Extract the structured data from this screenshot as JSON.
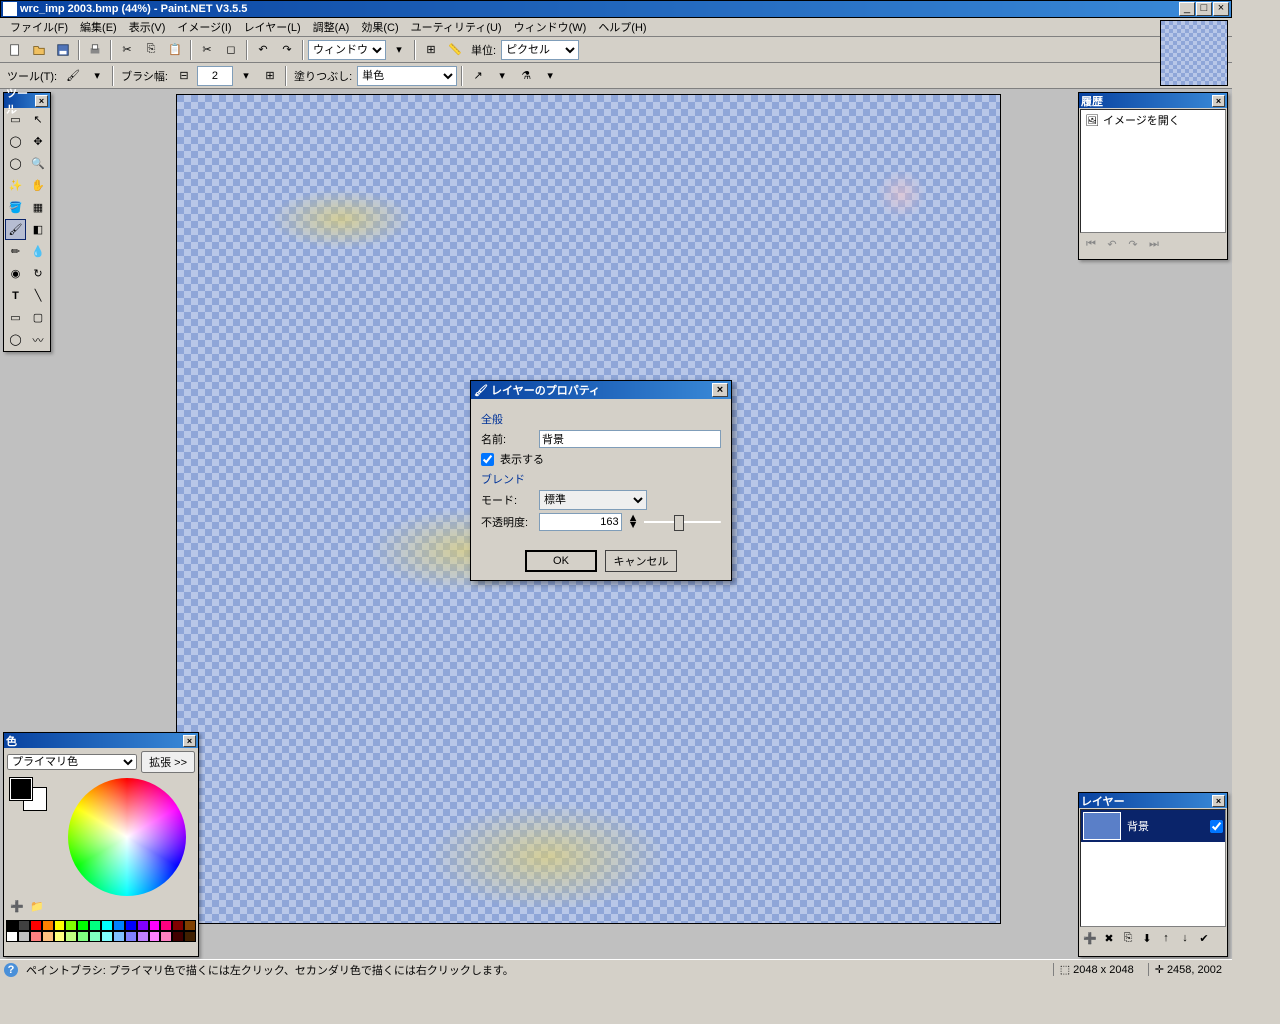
{
  "title": "wrc_imp 2003.bmp (44%) - Paint.NET V3.5.5",
  "menu": {
    "file": "ファイル(F)",
    "edit": "編集(E)",
    "view": "表示(V)",
    "image": "イメージ(I)",
    "layers": "レイヤー(L)",
    "adjust": "調整(A)",
    "effects": "効果(C)",
    "utility": "ユーティリティ(U)",
    "window": "ウィンドウ(W)",
    "help": "ヘルプ(H)"
  },
  "tb1": {
    "zoom_sel": "ウィンドウ",
    "unit_lbl": "単位:",
    "unit_sel": "ピクセル"
  },
  "tb2": {
    "tool_lbl": "ツール(T):",
    "brush_lbl": "ブラシ幅:",
    "brush_val": "2",
    "fill_lbl": "塗りつぶし:",
    "fill_sel": "単色"
  },
  "tools_panel": {
    "title": "ツール"
  },
  "history": {
    "title": "履歴",
    "item1": "イメージを開く"
  },
  "layers": {
    "title": "レイヤー",
    "row1": "背景"
  },
  "colors": {
    "title": "色",
    "sel": "プライマリ色",
    "btn": "拡張 >>"
  },
  "dialog": {
    "title": "レイヤーのプロパティ",
    "sect1": "全般",
    "name_lbl": "名前:",
    "name_val": "背景",
    "visible": "表示する",
    "sect2": "ブレンド",
    "mode_lbl": "モード:",
    "mode_val": "標準",
    "opacity_lbl": "不透明度:",
    "opacity_val": "163",
    "ok": "OK",
    "cancel": "キャンセル"
  },
  "status": {
    "text": "ペイントブラシ: プライマリ色で描くには左クリック、セカンダリ色で描くには右クリックします。",
    "dims": "2048 x 2048",
    "pos": "2458, 2002"
  },
  "palette": [
    "#000",
    "#404040",
    "#f00",
    "#ff8000",
    "#ff0",
    "#80ff00",
    "#0f0",
    "#00ff80",
    "#0ff",
    "#0080ff",
    "#00f",
    "#8000ff",
    "#f0f",
    "#ff0080",
    "#800000",
    "#804000",
    "#fff",
    "#c0c0c0",
    "#ff8080",
    "#ffc080",
    "#ffff80",
    "#c0ff80",
    "#80ff80",
    "#80ffc0",
    "#80ffff",
    "#80c0ff",
    "#8080ff",
    "#c080ff",
    "#ff80ff",
    "#ff80c0",
    "#400000",
    "#402000"
  ]
}
